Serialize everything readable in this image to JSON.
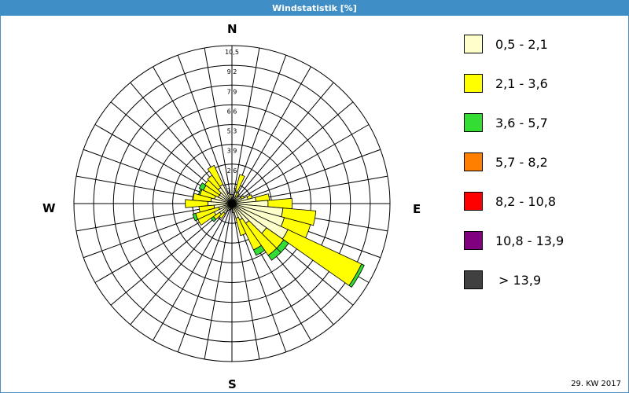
{
  "window": {
    "title": "Windstatistik [%]"
  },
  "footer": {
    "week": "29. KW 2017"
  },
  "directions": {
    "n": "N",
    "e": "E",
    "s": "S",
    "w": "W"
  },
  "legend": [
    {
      "label": "0,5 - 2,1",
      "color": "#ffffcc"
    },
    {
      "label": "2,1 - 3,6",
      "color": "#ffff00"
    },
    {
      "label": "3,6 - 5,7",
      "color": "#33dd33"
    },
    {
      "label": "5,7 - 8,2",
      "color": "#ff8000"
    },
    {
      "label": "8,2 - 10,8",
      "color": "#ff0000"
    },
    {
      "label": "10,8 - 13,9",
      "color": "#800080"
    },
    {
      "label": "> 13,9",
      "color": "#404040"
    }
  ],
  "chart_data": {
    "type": "wind-rose",
    "radial_ticks": [
      "1,3",
      "2,6",
      "3,9",
      "5,3",
      "6,6",
      "7,9",
      "9,2",
      "10,5"
    ],
    "rmax": 10.5,
    "sector_count": 36,
    "sectors": [
      {
        "dir": 0,
        "bins": [
          0.6,
          0.0
        ]
      },
      {
        "dir": 10,
        "bins": [
          0.4,
          0.0
        ]
      },
      {
        "dir": 20,
        "bins": [
          0.8,
          1.2
        ]
      },
      {
        "dir": 30,
        "bins": [
          0.5,
          0.3
        ]
      },
      {
        "dir": 40,
        "bins": [
          0.6,
          0.0
        ]
      },
      {
        "dir": 50,
        "bins": [
          0.7,
          0.0
        ]
      },
      {
        "dir": 60,
        "bins": [
          0.7,
          0.2
        ]
      },
      {
        "dir": 70,
        "bins": [
          1.1,
          0.3
        ]
      },
      {
        "dir": 80,
        "bins": [
          1.6,
          0.9
        ]
      },
      {
        "dir": 90,
        "bins": [
          2.4,
          1.6
        ]
      },
      {
        "dir": 100,
        "bins": [
          3.4,
          2.2
        ]
      },
      {
        "dir": 110,
        "bins": [
          3.6,
          1.8
        ]
      },
      {
        "dir": 120,
        "bins": [
          4.1,
          5.4,
          0.2
        ]
      },
      {
        "dir": 130,
        "bins": [
          2.8,
          1.4,
          0.4
        ]
      },
      {
        "dir": 140,
        "bins": [
          1.6,
          2.6,
          0.4
        ]
      },
      {
        "dir": 150,
        "bins": [
          1.2,
          2.2,
          0.4
        ]
      },
      {
        "dir": 160,
        "bins": [
          1.0,
          1.2
        ]
      },
      {
        "dir": 170,
        "bins": [
          0.6,
          0.0
        ]
      },
      {
        "dir": 180,
        "bins": [
          0.3,
          0.0
        ]
      },
      {
        "dir": 190,
        "bins": [
          0.3,
          0.0
        ]
      },
      {
        "dir": 200,
        "bins": [
          0.4,
          0.0
        ]
      },
      {
        "dir": 210,
        "bins": [
          0.5,
          0.0
        ]
      },
      {
        "dir": 220,
        "bins": [
          0.8,
          0.4
        ]
      },
      {
        "dir": 230,
        "bins": [
          1.0,
          0.5,
          0.2
        ]
      },
      {
        "dir": 240,
        "bins": [
          1.3,
          1.2
        ]
      },
      {
        "dir": 250,
        "bins": [
          0.9,
          1.6,
          0.2
        ]
      },
      {
        "dir": 260,
        "bins": [
          1.2,
          1.0
        ]
      },
      {
        "dir": 270,
        "bins": [
          1.6,
          1.5
        ]
      },
      {
        "dir": 280,
        "bins": [
          1.4,
          1.2
        ]
      },
      {
        "dir": 290,
        "bins": [
          1.2,
          1.0,
          0.1
        ]
      },
      {
        "dir": 300,
        "bins": [
          1.0,
          1.1,
          0.3
        ]
      },
      {
        "dir": 310,
        "bins": [
          1.0,
          1.2
        ]
      },
      {
        "dir": 320,
        "bins": [
          1.3,
          1.0
        ]
      },
      {
        "dir": 330,
        "bins": [
          1.4,
          1.4
        ]
      },
      {
        "dir": 340,
        "bins": [
          0.7,
          0.0
        ]
      },
      {
        "dir": 350,
        "bins": [
          0.6,
          0.0
        ]
      }
    ]
  }
}
